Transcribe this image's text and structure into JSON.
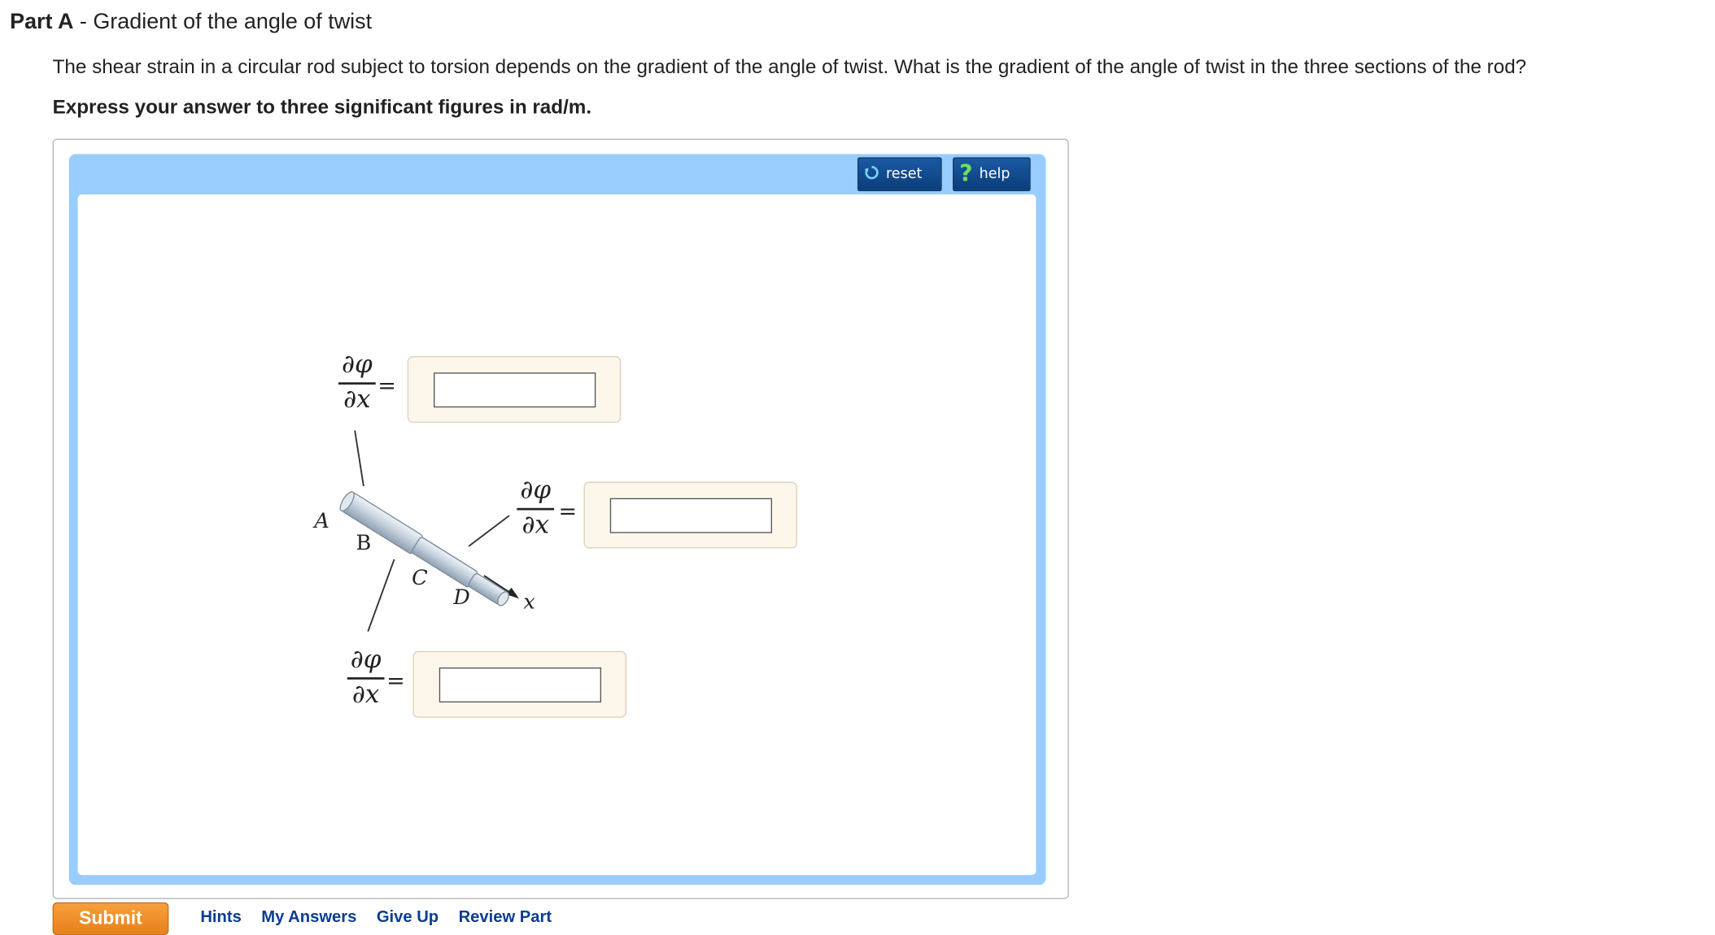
{
  "part": {
    "label": "Part A",
    "separator": " - ",
    "title": "Gradient of the angle of twist"
  },
  "question": "The shear strain in a circular rod subject to torsion depends on the gradient of the angle of twist. What is the gradient of the angle of twist in the three sections of the rod?",
  "instruction": "Express your answer to three significant figures in rad/m.",
  "toolbar": {
    "reset_label": "reset",
    "help_label": "help",
    "reset_icon": "reset-icon",
    "help_icon": "help-icon",
    "accent_color": "#99ccff"
  },
  "figure": {
    "derivative_numerator": "∂φ",
    "derivative_denominator": "∂x",
    "equals": "=",
    "point_labels": [
      "A",
      "B",
      "C",
      "D",
      "x"
    ],
    "answers": [
      {
        "section": "AB",
        "value": "",
        "placeholder": ""
      },
      {
        "section": "BC",
        "value": "",
        "placeholder": ""
      },
      {
        "section": "CD",
        "value": "",
        "placeholder": ""
      }
    ]
  },
  "actions": {
    "submit_label": "Submit",
    "links": [
      "Hints",
      "My Answers",
      "Give Up",
      "Review Part"
    ],
    "submit_color": "#f0901f",
    "link_color": "#0b3d91"
  }
}
